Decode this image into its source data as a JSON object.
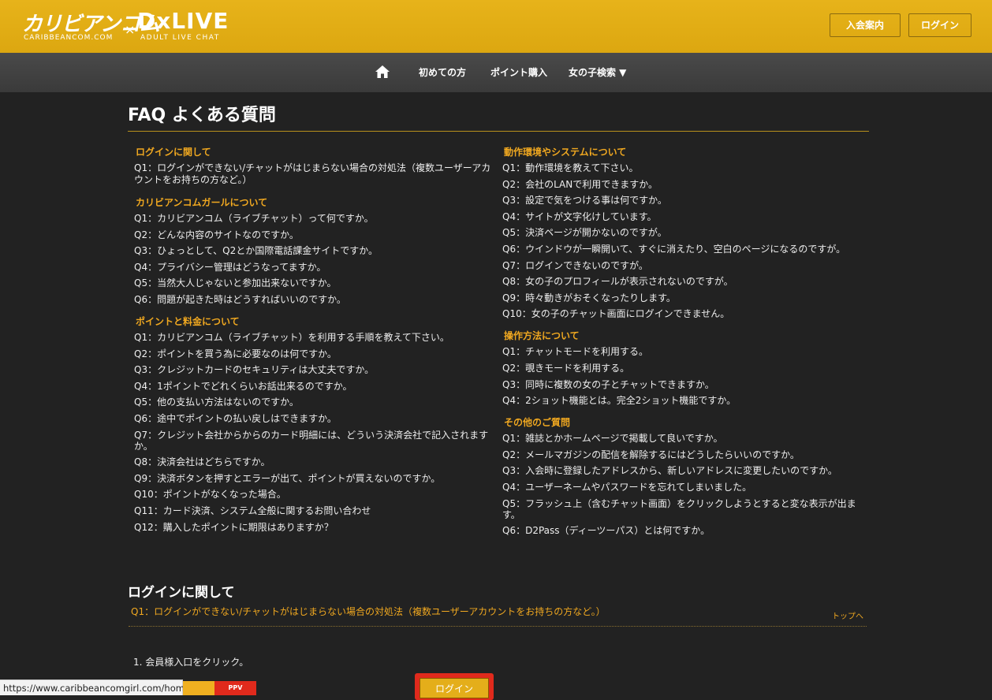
{
  "header": {
    "logo_jp": "カリビアンコム",
    "logo_x": "×",
    "logo_dx": "DxLIVE",
    "logo_sub1": "CARIBBEANCOM.COM",
    "logo_sub2": "ADULT LIVE CHAT",
    "join_label": "入会案内",
    "login_label": "ログイン"
  },
  "nav": {
    "items": [
      "初めての方",
      "ポイント購入",
      "女の子検索 ▼"
    ]
  },
  "page_title": "FAQ よくある質問",
  "left_sections": [
    {
      "heading": "ログインに関して",
      "questions": [
        "Q1：ログインができない/チャットがはじまらない場合の対処法（複数ユーザーアカウントをお持ちの方など。）"
      ]
    },
    {
      "heading": "カリビアンコムガールについて",
      "questions": [
        "Q1：カリビアンコム（ライブチャット）って何ですか。",
        "Q2：どんな内容のサイトなのですか。",
        "Q3：ひょっとして、Q2とか国際電話課金サイトですか。",
        "Q4：プライバシー管理はどうなってますか。",
        "Q5：当然大人じゃないと参加出来ないですか。",
        "Q6：問題が起きた時はどうすればいいのですか。"
      ]
    },
    {
      "heading": "ポイントと料金について",
      "questions": [
        "Q1：カリビアンコム（ライブチャット）を利用する手順を教えて下さい。",
        "Q2：ポイントを買う為に必要なのは何ですか。",
        "Q3：クレジットカードのセキュリティは大丈夫ですか。",
        "Q4：1ポイントでどれくらいお話出来るのですか。",
        "Q5：他の支払い方法はないのですか。",
        "Q6：途中でポイントの払い戻しはできますか。",
        "Q7：クレジット会社からからのカード明細には、どういう決済会社で記入されますか。",
        "Q8：決済会社はどちらですか。",
        "Q9：決済ボタンを押すとエラーが出て、ポイントが買えないのですか。",
        "Q10：ポイントがなくなった場合。",
        "Q11：カード決済、システム全般に関するお問い合わせ",
        "Q12：購入したポイントに期限はありますか？"
      ]
    }
  ],
  "right_sections": [
    {
      "heading": "動作環境やシステムについて",
      "questions": [
        "Q1：動作環境を教えて下さい。",
        "Q2：会社のLANで利用できますか。",
        "Q3：設定で気をつける事は何ですか。",
        "Q4：サイトが文字化けしています。",
        "Q5：決済ページが開かないのですが。",
        "Q6：ウインドウが一瞬開いて、すぐに消えたり、空白のページになるのですが。",
        "Q7：ログインできないのですが。",
        "Q8：女の子のプロフィールが表示されないのですが。",
        "Q9：時々動きがおそくなったりします。",
        "Q10：女の子のチャット画面にログインできません。"
      ]
    },
    {
      "heading": "操作方法について",
      "questions": [
        "Q1：チャットモードを利用する。",
        "Q2：覗きモードを利用する。",
        "Q3：同時に複数の女の子とチャットできますか。",
        "Q4：2ショット機能とは。完全2ショット機能ですか。"
      ]
    },
    {
      "heading": "その他のご質問",
      "questions": [
        "Q1：雑誌とかホームページで掲載して良いですか。",
        "Q2：メールマガジンの配信を解除するにはどうしたらいいのですか。",
        "Q3：入会時に登録したアドレスから、新しいアドレスに変更したいのですか。",
        "Q4：ユーザーネームやパスワードを忘れてしまいました。",
        "Q5：フラッシュ上（含むチャット画面）をクリックしようとすると変な表示が出ます。",
        "Q6：D2Pass（ディーツーパス）とは何ですか。"
      ]
    }
  ],
  "detail": {
    "heading": "ログインに関して",
    "question": "Q1：ログインができない/チャットがはじまらない場合の対処法（複数ユーザーアカウントをお持ちの方など。）",
    "top_link": "トップへ",
    "step1": "1. 会員様入口をクリック。",
    "login_image_label": "ログイン"
  },
  "status_url": "https://www.caribbeancomgirl.com/home",
  "banner_label": "PPV"
}
